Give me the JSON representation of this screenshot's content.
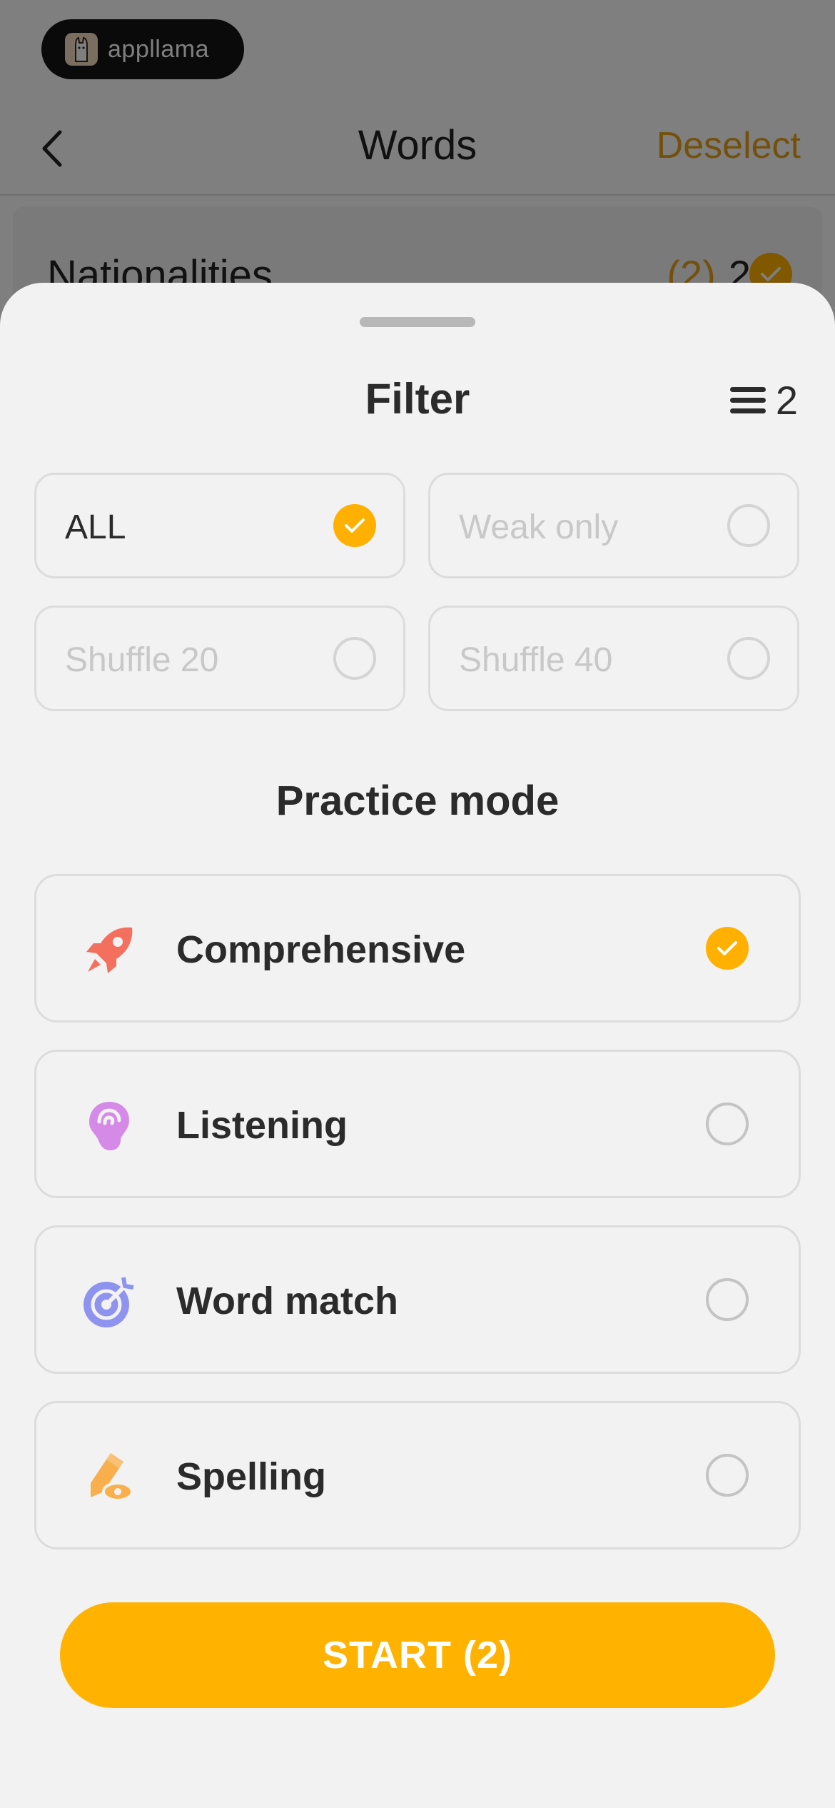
{
  "brand": {
    "name": "appllama"
  },
  "nav": {
    "title": "Words",
    "deselect": "Deselect"
  },
  "list": {
    "label": "Nationalities",
    "weak_count": "(2)",
    "count": "2"
  },
  "sheet": {
    "title": "Filter",
    "filter_count": "2"
  },
  "filters": [
    {
      "label": "ALL",
      "selected": true
    },
    {
      "label": "Weak only",
      "selected": false
    },
    {
      "label": "Shuffle 20",
      "selected": false
    },
    {
      "label": "Shuffle 40",
      "selected": false
    }
  ],
  "practice": {
    "title": "Practice mode",
    "modes": [
      {
        "label": "Comprehensive",
        "icon": "rocket-icon",
        "color": "#f3705f",
        "selected": true
      },
      {
        "label": "Listening",
        "icon": "ear-icon",
        "color": "#d58ae8",
        "selected": false
      },
      {
        "label": "Word match",
        "icon": "target-icon",
        "color": "#8f93f0",
        "selected": false
      },
      {
        "label": "Spelling",
        "icon": "pencil-eye-icon",
        "color": "#f9b04c",
        "selected": false
      }
    ]
  },
  "start": {
    "label": "START (2)"
  },
  "colors": {
    "accent": "#ffb000",
    "deselect": "#e6a21a",
    "sheet_bg": "#f2f2f2"
  }
}
